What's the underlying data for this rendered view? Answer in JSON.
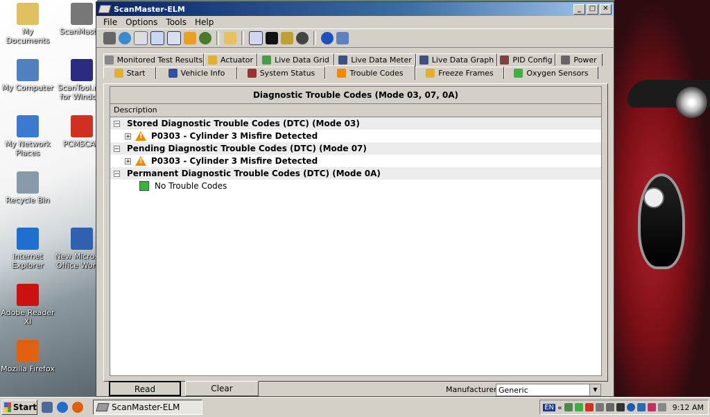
{
  "desktop": {
    "icons": [
      {
        "label": "My Documents",
        "color": "#e0c060"
      },
      {
        "label": "ScanMaster",
        "color": "#777777"
      },
      {
        "label": "My Computer",
        "color": "#5080c0"
      },
      {
        "label": "ScanTool.net for Windo...",
        "color": "#2b2b80"
      },
      {
        "label": "My Network Places",
        "color": "#3a7ad0"
      },
      {
        "label": "PCMSCAN",
        "color": "#d03020"
      },
      {
        "label": "Recycle Bin",
        "color": "#8899aa"
      },
      {
        "label": "Internet Explorer",
        "color": "#1e6fd0"
      },
      {
        "label": "New Microsoft Office Word...",
        "color": "#3060b0"
      },
      {
        "label": "Adobe Reader XI",
        "color": "#cc1111"
      },
      {
        "label": "Mozilla Firefox",
        "color": "#e06010"
      }
    ]
  },
  "window": {
    "title": "ScanMaster-ELM",
    "menu": [
      "File",
      "Options",
      "Tools",
      "Help"
    ],
    "tabs_row1": [
      {
        "label": "Monitored Test Results",
        "icon": "gear-icon",
        "color": "#888"
      },
      {
        "label": "Actuator",
        "icon": "actuator-icon",
        "color": "#e0b030"
      },
      {
        "label": "Live Data Grid",
        "icon": "grid-icon",
        "color": "#4a9a4a"
      },
      {
        "label": "Live Data Meter",
        "icon": "meter-icon",
        "color": "#405080"
      },
      {
        "label": "Live Data Graph",
        "icon": "graph-icon",
        "color": "#405080"
      },
      {
        "label": "PID Config",
        "icon": "config-icon",
        "color": "#804040"
      },
      {
        "label": "Power",
        "icon": "power-icon",
        "color": "#666"
      }
    ],
    "tabs_row2": [
      {
        "label": "Start",
        "icon": "start-icon",
        "color": "#e0b030"
      },
      {
        "label": "Vehicle Info",
        "icon": "info-icon",
        "color": "#3050a0"
      },
      {
        "label": "System Status",
        "icon": "status-icon",
        "color": "#a03030"
      },
      {
        "label": "Trouble Codes",
        "icon": "warning-icon",
        "color": "#f08a00",
        "active": true
      },
      {
        "label": "Freeze Frames",
        "icon": "freeze-icon",
        "color": "#e0b030"
      },
      {
        "label": "Oxygen Sensors",
        "icon": "oxygen-icon",
        "color": "#3cb043"
      }
    ],
    "panel_title": "Diagnostic Trouble Codes (Mode 03, 07, 0A)",
    "column_header": "Description",
    "groups": [
      {
        "label": "Stored Diagnostic Trouble Codes (DTC) (Mode 03)",
        "child": "P0303 - Cylinder 3 Misfire Detected",
        "child_type": "code"
      },
      {
        "label": "Pending Diagnostic Trouble Codes (DTC) (Mode 07)",
        "child": "P0303 - Cylinder 3 Misfire Detected",
        "child_type": "code"
      },
      {
        "label": "Permanent Diagnostic Trouble Codes (DTC) (Mode 0A)",
        "child": "No Trouble Codes",
        "child_type": "none"
      }
    ],
    "read_label": "Read",
    "clear_label": "Clear",
    "manufacturer_label": "Manufacturer",
    "manufacturer_value": "Generic"
  },
  "taskbar": {
    "start_label": "Start",
    "task_label": "ScanMaster-ELM",
    "lang": "EN",
    "time": "9:12 AM"
  }
}
